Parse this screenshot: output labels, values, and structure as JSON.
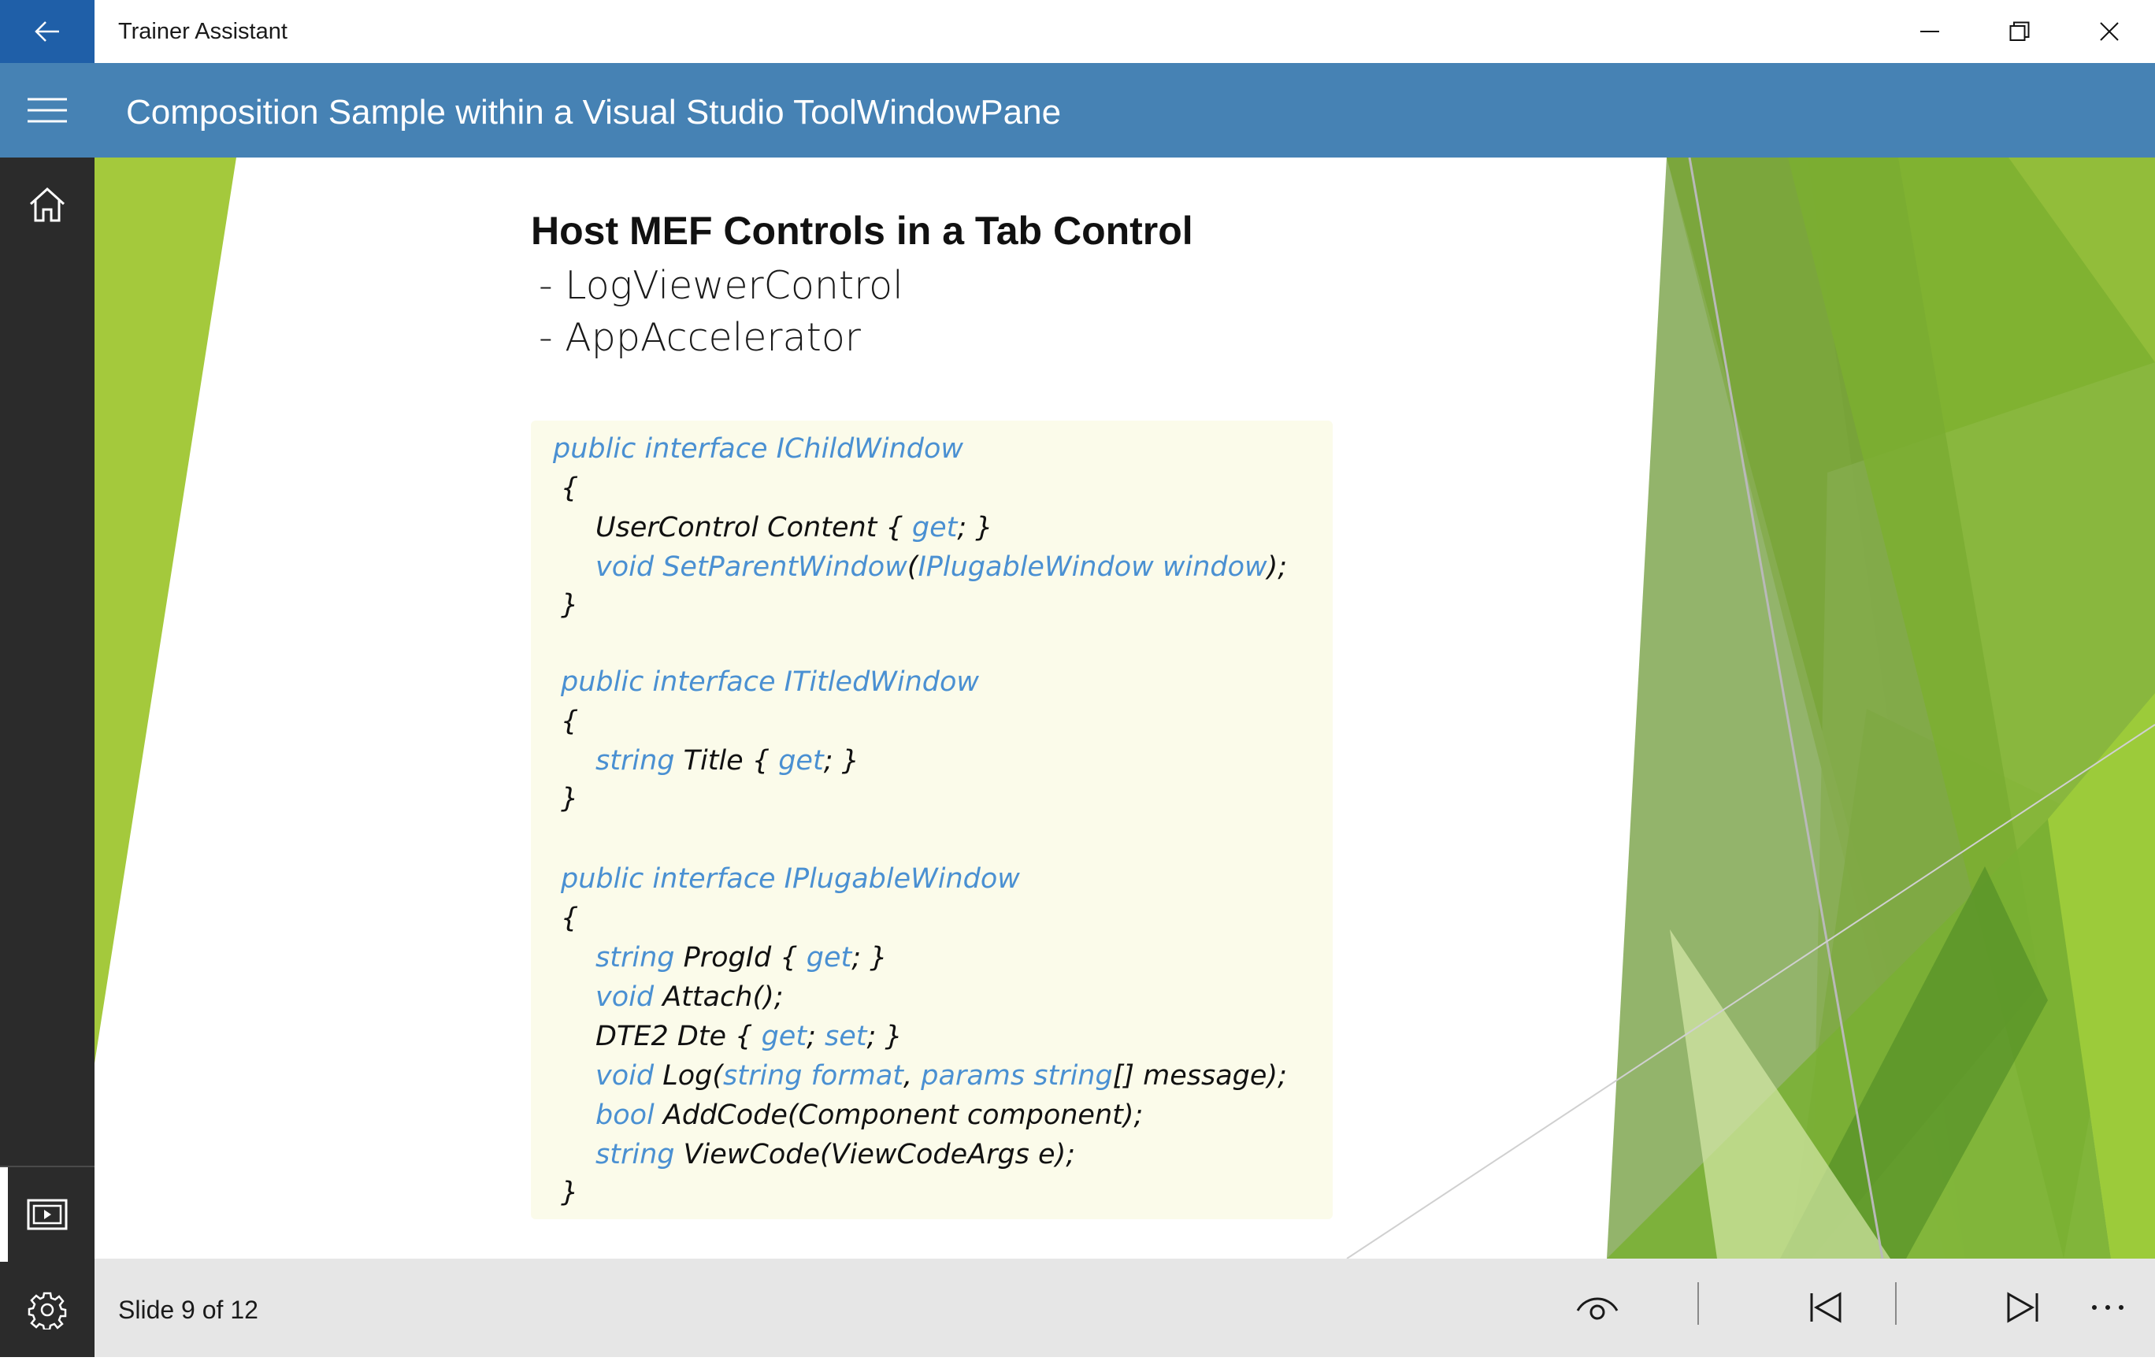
{
  "window": {
    "app_title": "Trainer Assistant",
    "back_icon": "back-arrow-icon",
    "minimize_icon": "minimize-icon",
    "maximize_icon": "restore-icon",
    "close_icon": "close-icon",
    "accent_color": "#1f5fa8"
  },
  "header": {
    "title": "Composition Sample within a Visual Studio ToolWindowPane",
    "menu_icon": "hamburger-icon",
    "color": "#4682b4"
  },
  "rail": {
    "home_icon": "home-icon",
    "slides_icon": "slideshow-icon",
    "settings_icon": "gear-icon"
  },
  "slide": {
    "heading": "Host MEF Controls in a Tab Control",
    "bullets": [
      "- LogViewerControl",
      "- AppAccelerator"
    ],
    "code": [
      {
        "segments": [
          {
            "t": "public interface IChildWindow",
            "c": "kw"
          }
        ]
      },
      {
        "segments": [
          {
            "t": "{",
            "c": ""
          }
        ]
      },
      {
        "segments": [
          {
            "t": "UserControl Content { ",
            "c": ""
          },
          {
            "t": "get",
            "c": "kw"
          },
          {
            "t": "; }",
            "c": ""
          }
        ]
      },
      {
        "segments": [
          {
            "t": "void SetParentWindow",
            "c": "kw"
          },
          {
            "t": "(",
            "c": ""
          },
          {
            "t": "IPlugableWindow window",
            "c": "kw"
          },
          {
            "t": ");",
            "c": ""
          }
        ]
      },
      {
        "segments": [
          {
            "t": "}",
            "c": ""
          }
        ]
      },
      {
        "segments": [
          {
            "t": "public interface ITitledWindow",
            "c": "kw"
          }
        ]
      },
      {
        "segments": [
          {
            "t": "{",
            "c": ""
          }
        ]
      },
      {
        "segments": [
          {
            "t": "string",
            "c": "kw"
          },
          {
            "t": " Title { ",
            "c": ""
          },
          {
            "t": "get",
            "c": "kw"
          },
          {
            "t": "; }",
            "c": ""
          }
        ]
      },
      {
        "segments": [
          {
            "t": "}",
            "c": ""
          }
        ]
      },
      {
        "segments": [
          {
            "t": "public interface IPlugableWindow",
            "c": "kw"
          }
        ]
      },
      {
        "segments": [
          {
            "t": "{",
            "c": ""
          }
        ]
      },
      {
        "segments": [
          {
            "t": "string",
            "c": "kw"
          },
          {
            "t": " ProgId { ",
            "c": ""
          },
          {
            "t": "get",
            "c": "kw"
          },
          {
            "t": "; }",
            "c": ""
          }
        ]
      },
      {
        "segments": [
          {
            "t": "void",
            "c": "kw"
          },
          {
            "t": " Attach();",
            "c": ""
          }
        ]
      },
      {
        "segments": [
          {
            "t": "DTE2 Dte { ",
            "c": ""
          },
          {
            "t": "get",
            "c": "kw"
          },
          {
            "t": "; ",
            "c": ""
          },
          {
            "t": "set",
            "c": "kw"
          },
          {
            "t": "; }",
            "c": ""
          }
        ]
      },
      {
        "segments": [
          {
            "t": "void",
            "c": "kw"
          },
          {
            "t": " Log(",
            "c": ""
          },
          {
            "t": "string format",
            "c": "kw"
          },
          {
            "t": ", ",
            "c": ""
          },
          {
            "t": "params string",
            "c": "kw"
          },
          {
            "t": "[] message);",
            "c": ""
          }
        ]
      },
      {
        "segments": [
          {
            "t": "bool",
            "c": "kw"
          },
          {
            "t": " AddCode(Component component);",
            "c": ""
          }
        ]
      },
      {
        "segments": [
          {
            "t": "string",
            "c": "kw"
          },
          {
            "t": " ViewCode(ViewCodeArgs e);",
            "c": ""
          }
        ]
      },
      {
        "segments": [
          {
            "t": "}",
            "c": ""
          }
        ]
      }
    ]
  },
  "footer": {
    "slide_counter": "Slide 9 of 12",
    "view_icon": "eye-icon",
    "prev_icon": "skip-previous-icon",
    "next_icon": "skip-next-icon",
    "more_icon": "more-icon"
  }
}
